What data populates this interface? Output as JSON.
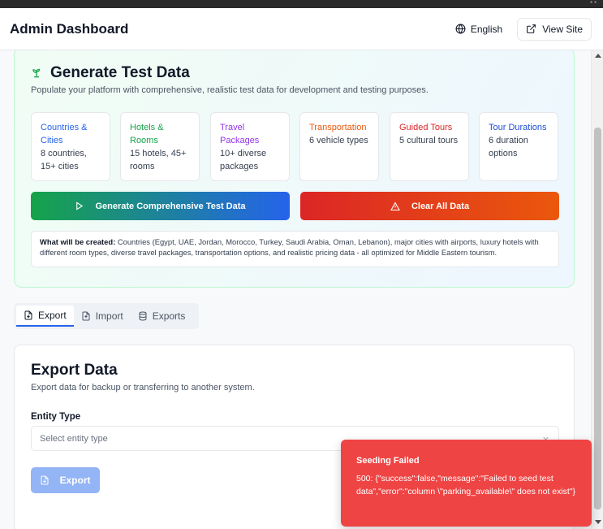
{
  "header": {
    "title": "Admin Dashboard",
    "language_label": "English",
    "view_site_label": "View Site"
  },
  "generate": {
    "title": "Generate Test Data",
    "description": "Populate your platform with comprehensive, realistic test data for development and testing purposes.",
    "stats": [
      {
        "title": "Countries & Cities",
        "desc": "8 countries, 15+ cities",
        "color": "#2563eb"
      },
      {
        "title": "Hotels & Rooms",
        "desc": "15 hotels, 45+ rooms",
        "color": "#16a34a"
      },
      {
        "title": "Travel Packages",
        "desc": "10+ diverse packages",
        "color": "#9333ea"
      },
      {
        "title": "Transportation",
        "desc": "6 vehicle types",
        "color": "#ea580c"
      },
      {
        "title": "Guided Tours",
        "desc": "5 cultural tours",
        "color": "#dc2626"
      },
      {
        "title": "Tour Durations",
        "desc": "6 duration options",
        "color": "#1d4ed8"
      }
    ],
    "generate_button": "Generate Comprehensive Test Data",
    "clear_button": "Clear All Data",
    "note_label": "What will be created:",
    "note_text": " Countries (Egypt, UAE, Jordan, Morocco, Turkey, Saudi Arabia, Oman, Lebanon), major cities with airports, luxury hotels with different room types, diverse travel packages, transportation options, and realistic pricing data - all optimized for Middle Eastern tourism."
  },
  "tabs": [
    {
      "label": "Export",
      "active": true
    },
    {
      "label": "Import",
      "active": false
    },
    {
      "label": "Exports",
      "active": false
    }
  ],
  "export": {
    "title": "Export Data",
    "description": "Export data for backup or transferring to another system.",
    "entity_label": "Entity Type",
    "select_placeholder": "Select entity type",
    "button": "Export"
  },
  "toast": {
    "title": "Seeding Failed",
    "message": "500: {\"success\":false,\"message\":\"Failed to seed test data\",\"error\":\"column \\\"parking_available\\\" does not exist\"}"
  },
  "colors": {
    "accent": "#2563eb",
    "danger": "#ef4444"
  }
}
